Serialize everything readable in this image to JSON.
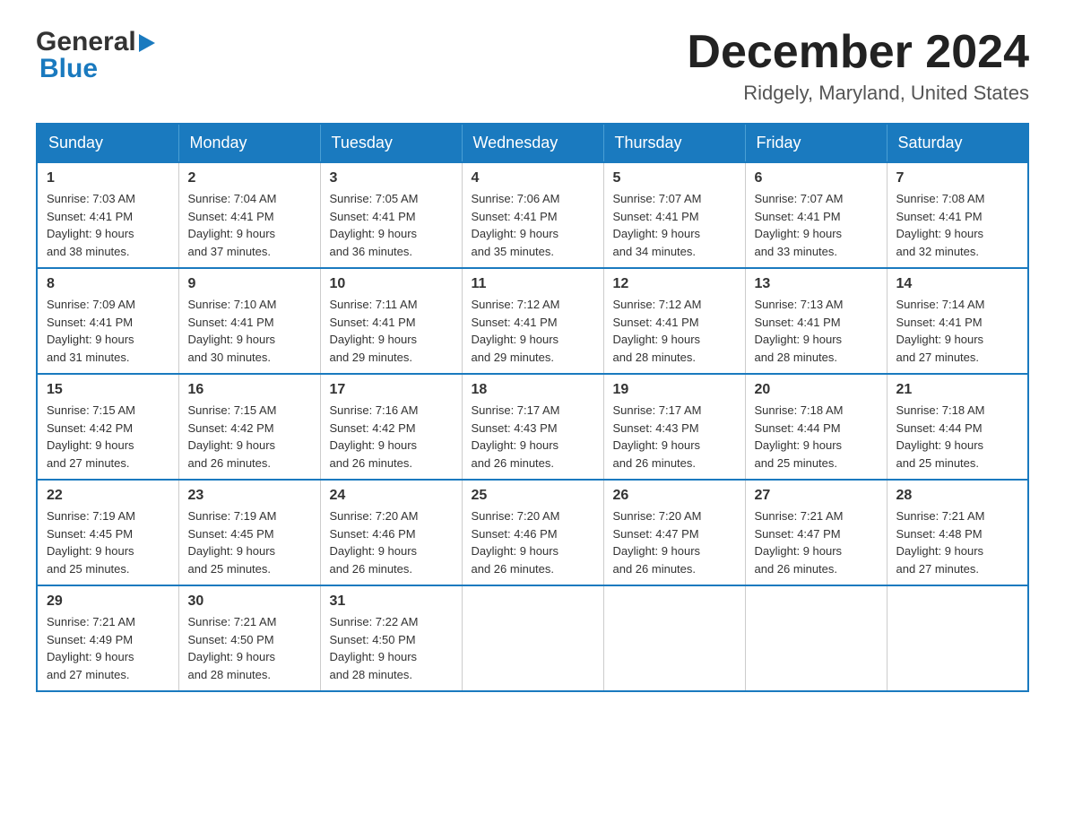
{
  "header": {
    "logo_text_general": "General",
    "logo_text_blue": "Blue",
    "month_title": "December 2024",
    "location": "Ridgely, Maryland, United States"
  },
  "days_of_week": [
    "Sunday",
    "Monday",
    "Tuesday",
    "Wednesday",
    "Thursday",
    "Friday",
    "Saturday"
  ],
  "weeks": [
    [
      {
        "day": "1",
        "sunrise": "7:03 AM",
        "sunset": "4:41 PM",
        "daylight": "9 hours and 38 minutes."
      },
      {
        "day": "2",
        "sunrise": "7:04 AM",
        "sunset": "4:41 PM",
        "daylight": "9 hours and 37 minutes."
      },
      {
        "day": "3",
        "sunrise": "7:05 AM",
        "sunset": "4:41 PM",
        "daylight": "9 hours and 36 minutes."
      },
      {
        "day": "4",
        "sunrise": "7:06 AM",
        "sunset": "4:41 PM",
        "daylight": "9 hours and 35 minutes."
      },
      {
        "day": "5",
        "sunrise": "7:07 AM",
        "sunset": "4:41 PM",
        "daylight": "9 hours and 34 minutes."
      },
      {
        "day": "6",
        "sunrise": "7:07 AM",
        "sunset": "4:41 PM",
        "daylight": "9 hours and 33 minutes."
      },
      {
        "day": "7",
        "sunrise": "7:08 AM",
        "sunset": "4:41 PM",
        "daylight": "9 hours and 32 minutes."
      }
    ],
    [
      {
        "day": "8",
        "sunrise": "7:09 AM",
        "sunset": "4:41 PM",
        "daylight": "9 hours and 31 minutes."
      },
      {
        "day": "9",
        "sunrise": "7:10 AM",
        "sunset": "4:41 PM",
        "daylight": "9 hours and 30 minutes."
      },
      {
        "day": "10",
        "sunrise": "7:11 AM",
        "sunset": "4:41 PM",
        "daylight": "9 hours and 29 minutes."
      },
      {
        "day": "11",
        "sunrise": "7:12 AM",
        "sunset": "4:41 PM",
        "daylight": "9 hours and 29 minutes."
      },
      {
        "day": "12",
        "sunrise": "7:12 AM",
        "sunset": "4:41 PM",
        "daylight": "9 hours and 28 minutes."
      },
      {
        "day": "13",
        "sunrise": "7:13 AM",
        "sunset": "4:41 PM",
        "daylight": "9 hours and 28 minutes."
      },
      {
        "day": "14",
        "sunrise": "7:14 AM",
        "sunset": "4:41 PM",
        "daylight": "9 hours and 27 minutes."
      }
    ],
    [
      {
        "day": "15",
        "sunrise": "7:15 AM",
        "sunset": "4:42 PM",
        "daylight": "9 hours and 27 minutes."
      },
      {
        "day": "16",
        "sunrise": "7:15 AM",
        "sunset": "4:42 PM",
        "daylight": "9 hours and 26 minutes."
      },
      {
        "day": "17",
        "sunrise": "7:16 AM",
        "sunset": "4:42 PM",
        "daylight": "9 hours and 26 minutes."
      },
      {
        "day": "18",
        "sunrise": "7:17 AM",
        "sunset": "4:43 PM",
        "daylight": "9 hours and 26 minutes."
      },
      {
        "day": "19",
        "sunrise": "7:17 AM",
        "sunset": "4:43 PM",
        "daylight": "9 hours and 26 minutes."
      },
      {
        "day": "20",
        "sunrise": "7:18 AM",
        "sunset": "4:44 PM",
        "daylight": "9 hours and 25 minutes."
      },
      {
        "day": "21",
        "sunrise": "7:18 AM",
        "sunset": "4:44 PM",
        "daylight": "9 hours and 25 minutes."
      }
    ],
    [
      {
        "day": "22",
        "sunrise": "7:19 AM",
        "sunset": "4:45 PM",
        "daylight": "9 hours and 25 minutes."
      },
      {
        "day": "23",
        "sunrise": "7:19 AM",
        "sunset": "4:45 PM",
        "daylight": "9 hours and 25 minutes."
      },
      {
        "day": "24",
        "sunrise": "7:20 AM",
        "sunset": "4:46 PM",
        "daylight": "9 hours and 26 minutes."
      },
      {
        "day": "25",
        "sunrise": "7:20 AM",
        "sunset": "4:46 PM",
        "daylight": "9 hours and 26 minutes."
      },
      {
        "day": "26",
        "sunrise": "7:20 AM",
        "sunset": "4:47 PM",
        "daylight": "9 hours and 26 minutes."
      },
      {
        "day": "27",
        "sunrise": "7:21 AM",
        "sunset": "4:47 PM",
        "daylight": "9 hours and 26 minutes."
      },
      {
        "day": "28",
        "sunrise": "7:21 AM",
        "sunset": "4:48 PM",
        "daylight": "9 hours and 27 minutes."
      }
    ],
    [
      {
        "day": "29",
        "sunrise": "7:21 AM",
        "sunset": "4:49 PM",
        "daylight": "9 hours and 27 minutes."
      },
      {
        "day": "30",
        "sunrise": "7:21 AM",
        "sunset": "4:50 PM",
        "daylight": "9 hours and 28 minutes."
      },
      {
        "day": "31",
        "sunrise": "7:22 AM",
        "sunset": "4:50 PM",
        "daylight": "9 hours and 28 minutes."
      },
      null,
      null,
      null,
      null
    ]
  ],
  "labels": {
    "sunrise": "Sunrise:",
    "sunset": "Sunset:",
    "daylight": "Daylight:"
  }
}
